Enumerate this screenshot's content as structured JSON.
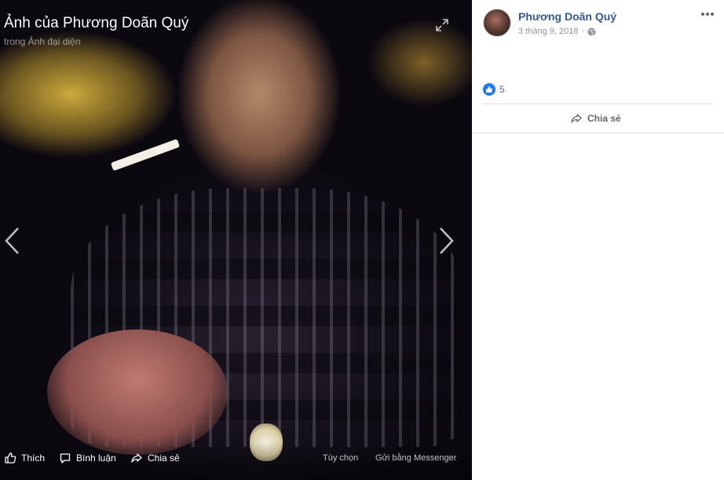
{
  "photo": {
    "title": "Ảnh của Phương Doãn Quý",
    "subtitle": "trong Ảnh đại diện"
  },
  "bottom_bar": {
    "like_label": "Thích",
    "comment_label": "Bình luận",
    "share_label": "Chia sẻ",
    "options_label": "Tùy chọn",
    "messenger_label": "Gửi bằng Messenger"
  },
  "post": {
    "author": "Phương Doãn Quý",
    "date": "3 tháng 9, 2018",
    "separator": "·",
    "reaction_count": "5",
    "share_label": "Chia sẻ"
  },
  "icons": {
    "expand": "expand-icon",
    "prev": "chevron-left-icon",
    "next": "chevron-right-icon",
    "like": "thumbs-up-icon",
    "comment": "comment-icon",
    "share": "share-arrow-icon",
    "privacy": "globe-icon",
    "more": "more-dots-icon",
    "reaction": "like-reaction-icon"
  },
  "colors": {
    "link_blue": "#365899",
    "reaction_blue": "#2078f4",
    "meta_gray": "#90949c",
    "divider": "#dddfe2"
  }
}
